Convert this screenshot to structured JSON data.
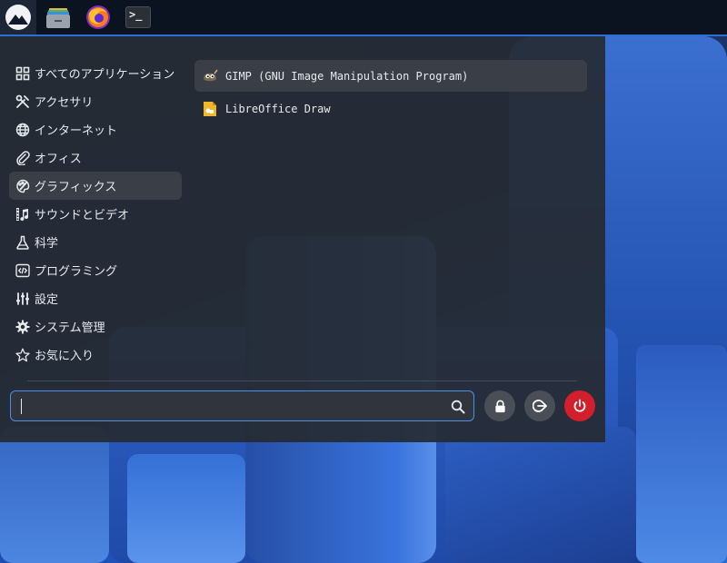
{
  "taskbar": {
    "start_icon": "mountain-logo-icon",
    "apps": [
      {
        "name": "files",
        "icon": "file-manager-icon"
      },
      {
        "name": "firefox",
        "icon": "firefox-icon"
      },
      {
        "name": "terminal",
        "icon": "terminal-icon",
        "glyph": ">_"
      }
    ]
  },
  "categories": [
    {
      "label": "すべてのアプリケーション",
      "icon": "grid-icon"
    },
    {
      "label": "アクセサリ",
      "icon": "tools-icon"
    },
    {
      "label": "インターネット",
      "icon": "globe-icon"
    },
    {
      "label": "オフィス",
      "icon": "paperclip-icon"
    },
    {
      "label": "グラフィックス",
      "icon": "palette-icon",
      "selected": true
    },
    {
      "label": "サウンドとビデオ",
      "icon": "film-music-icon"
    },
    {
      "label": "科学",
      "icon": "flask-icon"
    },
    {
      "label": "プログラミング",
      "icon": "code-icon"
    },
    {
      "label": "設定",
      "icon": "sliders-icon"
    },
    {
      "label": "システム管理",
      "icon": "gear-icon"
    },
    {
      "label": "お気に入り",
      "icon": "star-icon"
    }
  ],
  "apps": [
    {
      "label": "GIMP (GNU Image Manipulation Program)",
      "icon": "gimp-icon",
      "highlight": true
    },
    {
      "label": "LibreOffice Draw",
      "icon": "libreoffice-draw-icon"
    }
  ],
  "search": {
    "value": "",
    "placeholder": ""
  },
  "session_buttons": [
    {
      "name": "lock",
      "icon": "lock-icon"
    },
    {
      "name": "logout",
      "icon": "logout-icon"
    },
    {
      "name": "power",
      "icon": "power-icon"
    }
  ],
  "colors": {
    "accent": "#4d8ee8",
    "power": "#d11f2b",
    "panel": "#262b33",
    "selected": "#3a3f47"
  }
}
